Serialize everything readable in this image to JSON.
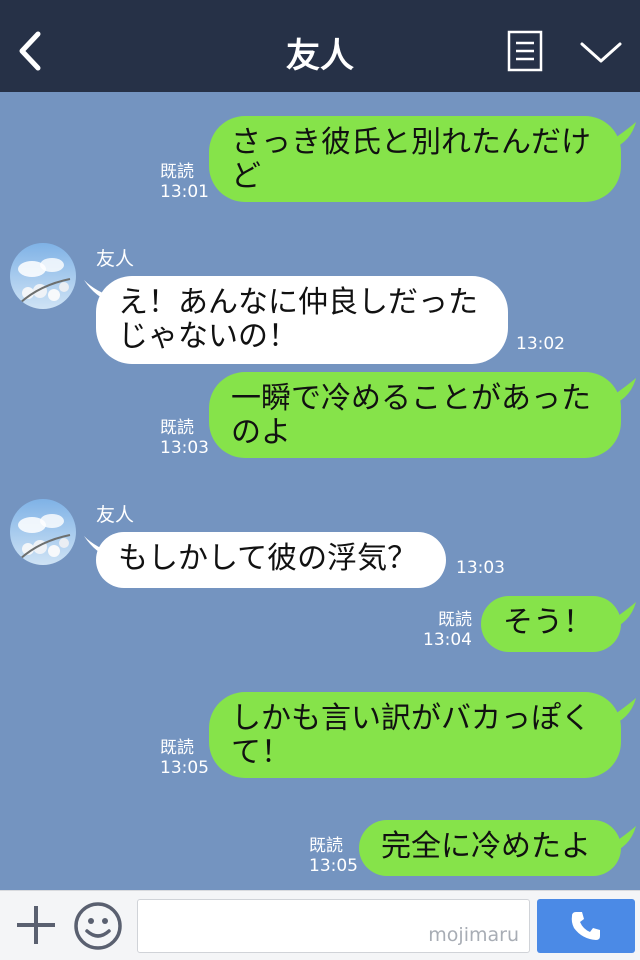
{
  "header": {
    "title": "友人"
  },
  "messages": [
    {
      "type": "sent",
      "lines": [
        "さっき彼氏と別れたんだけ",
        "ど"
      ],
      "read": "既読",
      "time": "13:01"
    },
    {
      "type": "recv",
      "sender": "友人",
      "lines": [
        "え！あんなに仲良しだった",
        "じゃないの！"
      ],
      "time": "13:02"
    },
    {
      "type": "sent",
      "lines": [
        "一瞬で冷めることがあった",
        "のよ"
      ],
      "read": "既読",
      "time": "13:03"
    },
    {
      "type": "recv",
      "sender": "友人",
      "lines": [
        "もしかして彼の浮気？"
      ],
      "time": "13:03"
    },
    {
      "type": "sent",
      "lines": [
        "そう！"
      ],
      "read": "既読",
      "time": "13:04"
    },
    {
      "type": "sent",
      "lines": [
        "しかも言い訳がバカっぽく",
        "て！"
      ],
      "read": "既読",
      "time": "13:05"
    },
    {
      "type": "sent",
      "lines": [
        "完全に冷めたよ"
      ],
      "read": "既読",
      "time": "13:05"
    }
  ],
  "input": {
    "watermark": "mojimaru"
  },
  "colors": {
    "header": "#263147",
    "chat_bg": "#7494c0",
    "sent_bubble": "#86e34a",
    "recv_bubble": "#ffffff",
    "call_button": "#4b8ae6"
  },
  "icons": [
    "back-arrow-icon",
    "menu-list-icon",
    "chevron-down-icon",
    "plus-icon",
    "emoji-icon",
    "phone-icon"
  ]
}
